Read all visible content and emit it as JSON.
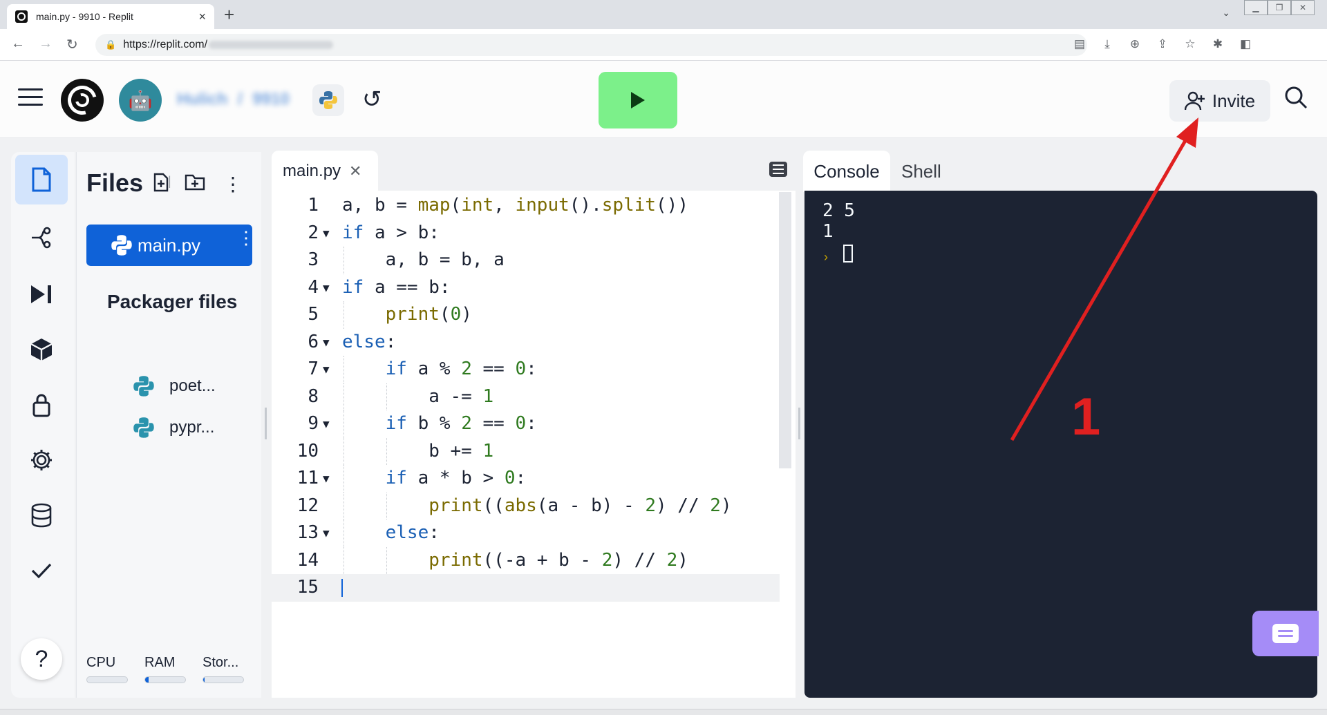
{
  "browser": {
    "tab_title": "main.py - 9910 - Replit",
    "url_prefix": "https://replit.com/",
    "new_tab": "+",
    "tab_close": "×"
  },
  "header": {
    "username": "Hulich",
    "separator": "/",
    "repl_name": "9910",
    "invite_label": "Invite"
  },
  "files": {
    "title": "Files",
    "active_file": "main.py",
    "packager_title": "Packager files",
    "packager_items": [
      "poet...",
      "pypr..."
    ],
    "resources": [
      {
        "label": "CPU",
        "usage": 0.0
      },
      {
        "label": "RAM",
        "usage": 0.08
      },
      {
        "label": "Stor...",
        "usage": 0.03
      }
    ]
  },
  "editor": {
    "tab_label": "main.py",
    "lines": [
      "a, b = map(int, input().split())",
      "if a > b:",
      "    a, b = b, a",
      "if a == b:",
      "    print(0)",
      "else:",
      "    if a % 2 == 0:",
      "        a -= 1",
      "    if b % 2 == 0:",
      "        b += 1",
      "    if a * b > 0:",
      "        print((abs(a - b) - 2) // 2)",
      "    else:",
      "        print((-a + b - 2) // 2)",
      ""
    ],
    "fold_lines": [
      2,
      4,
      6,
      7,
      9,
      11,
      13
    ],
    "current_line": 15
  },
  "console": {
    "tabs": [
      "Console",
      "Shell"
    ],
    "active_tab": "Console",
    "output": [
      "2 5",
      "1"
    ]
  },
  "annotation": {
    "label": "1",
    "color": "#e02020"
  },
  "colors": {
    "run_button": "#7cf08a",
    "accent": "#0f62d8",
    "console_bg": "#1c2333",
    "chat_button": "#a58cf7"
  }
}
